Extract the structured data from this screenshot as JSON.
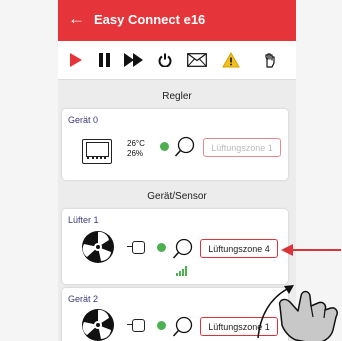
{
  "app": {
    "title": "Easy Connect e16"
  },
  "toolbar": {
    "icons": [
      "play-icon",
      "pause-icon",
      "fast-forward-icon",
      "power-icon",
      "mail-icon",
      "warning-icon",
      "hand-icon"
    ],
    "colors": {
      "play": "#e5343a",
      "warning": "#f0c020"
    }
  },
  "sections": {
    "regler": "Regler",
    "sensors": "Gerät/Sensor"
  },
  "controller": {
    "label": "Gerät 0",
    "temperature": "26°C",
    "humidity": "26%",
    "zone": "Lüftungszone 1"
  },
  "devices": [
    {
      "label": "Lüfter 1",
      "zone": "Lüftungszone 4"
    },
    {
      "label": "Gerät 2",
      "zone": "Lüftungszone 1"
    }
  ],
  "colors": {
    "accent": "#e5343a",
    "status": "#4caf50"
  }
}
